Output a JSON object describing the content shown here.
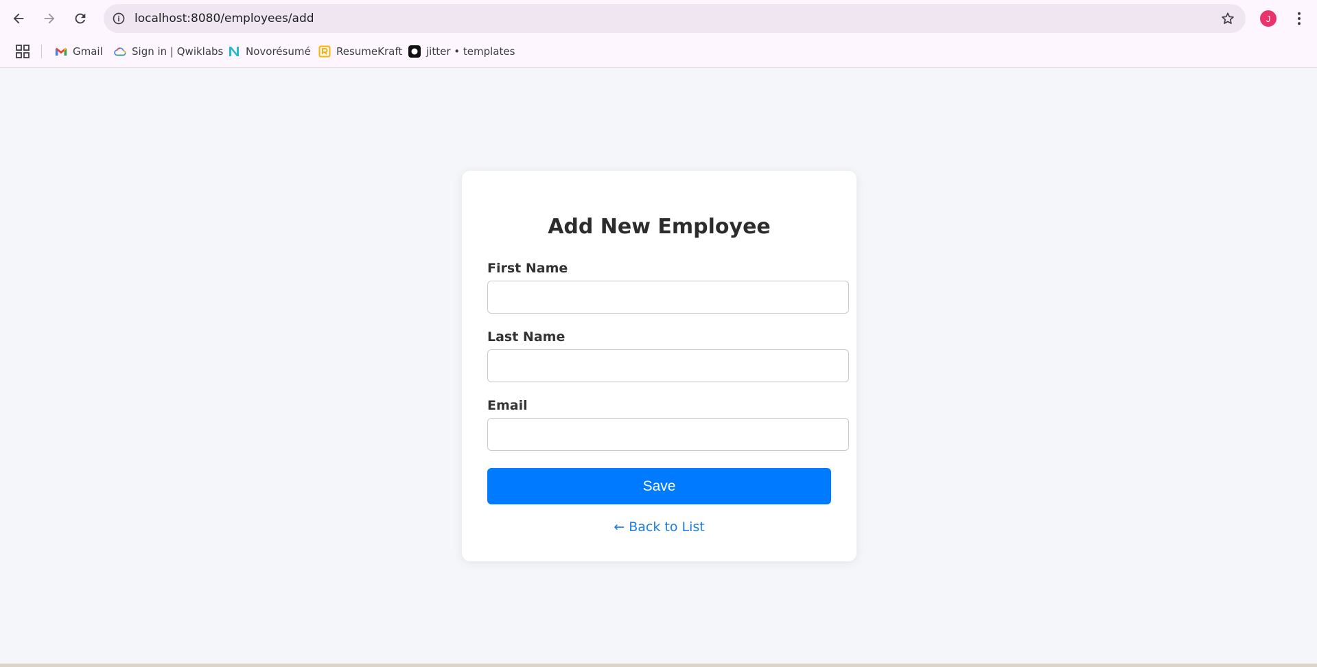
{
  "browser": {
    "url": "localhost:8080/employees/add",
    "profile_initial": "J",
    "accent_color": "#e8336d",
    "bookmarks": [
      {
        "label": "Gmail",
        "icon": "gmail-icon"
      },
      {
        "label": "Sign in | Qwiklabs",
        "icon": "google-cloud-icon"
      },
      {
        "label": "Novorésumé",
        "icon": "novoresume-icon"
      },
      {
        "label": "ResumeKraft",
        "icon": "resumekraft-icon"
      },
      {
        "label": "jitter • templates",
        "icon": "jitter-icon"
      }
    ]
  },
  "form": {
    "title": "Add New Employee",
    "fields": [
      {
        "label": "First Name",
        "value": "",
        "placeholder": ""
      },
      {
        "label": "Last Name",
        "value": "",
        "placeholder": ""
      },
      {
        "label": "Email",
        "value": "",
        "placeholder": ""
      }
    ],
    "save_label": "Save",
    "back_label": "← Back to List",
    "primary_color": "#007bff",
    "link_color": "#1a7fe0"
  }
}
